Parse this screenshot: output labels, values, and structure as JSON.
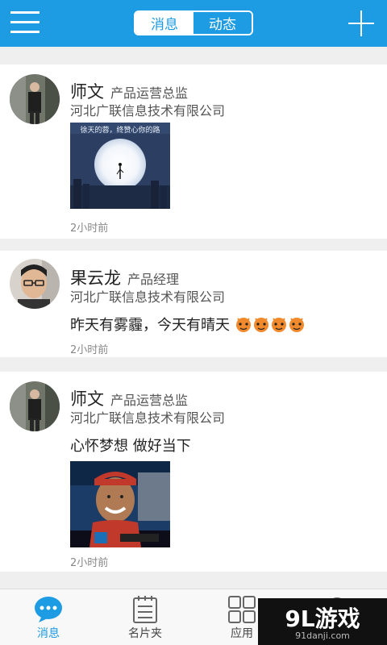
{
  "header": {
    "tabs": [
      {
        "label": "消息",
        "active": true
      },
      {
        "label": "动态",
        "active": false
      }
    ],
    "accent": "#1d9be3",
    "menu_icon": "hamburger-menu-icon",
    "add_icon": "plus-icon"
  },
  "feed": {
    "posts": [
      {
        "name": "师文",
        "title": "产品运营总监",
        "company": "河北广联信息技术有限公司",
        "text": "",
        "image_caption": "徐天的蓉，终赞心你的路",
        "time": "2小时前"
      },
      {
        "name": "果云龙",
        "title": "产品经理",
        "company": "河北广联信息技术有限公司",
        "text": "昨天有雾霾，今天有晴天",
        "emoji_count": 4,
        "time": "2小时前"
      },
      {
        "name": "师文",
        "title": "产品运营总监",
        "company": "河北广联信息技术有限公司",
        "text": "心怀梦想 做好当下",
        "time": "2小时前"
      }
    ]
  },
  "bottom_nav": {
    "items": [
      {
        "label": "消息",
        "icon": "chat-bubble-icon",
        "active": true
      },
      {
        "label": "名片夹",
        "icon": "notepad-icon",
        "active": false
      },
      {
        "label": "应用",
        "icon": "grid-apps-icon",
        "active": false
      },
      {
        "label": "",
        "icon": "search-icon",
        "active": false
      }
    ]
  },
  "watermark": {
    "main": "9L游戏",
    "url": "91danji.com"
  }
}
